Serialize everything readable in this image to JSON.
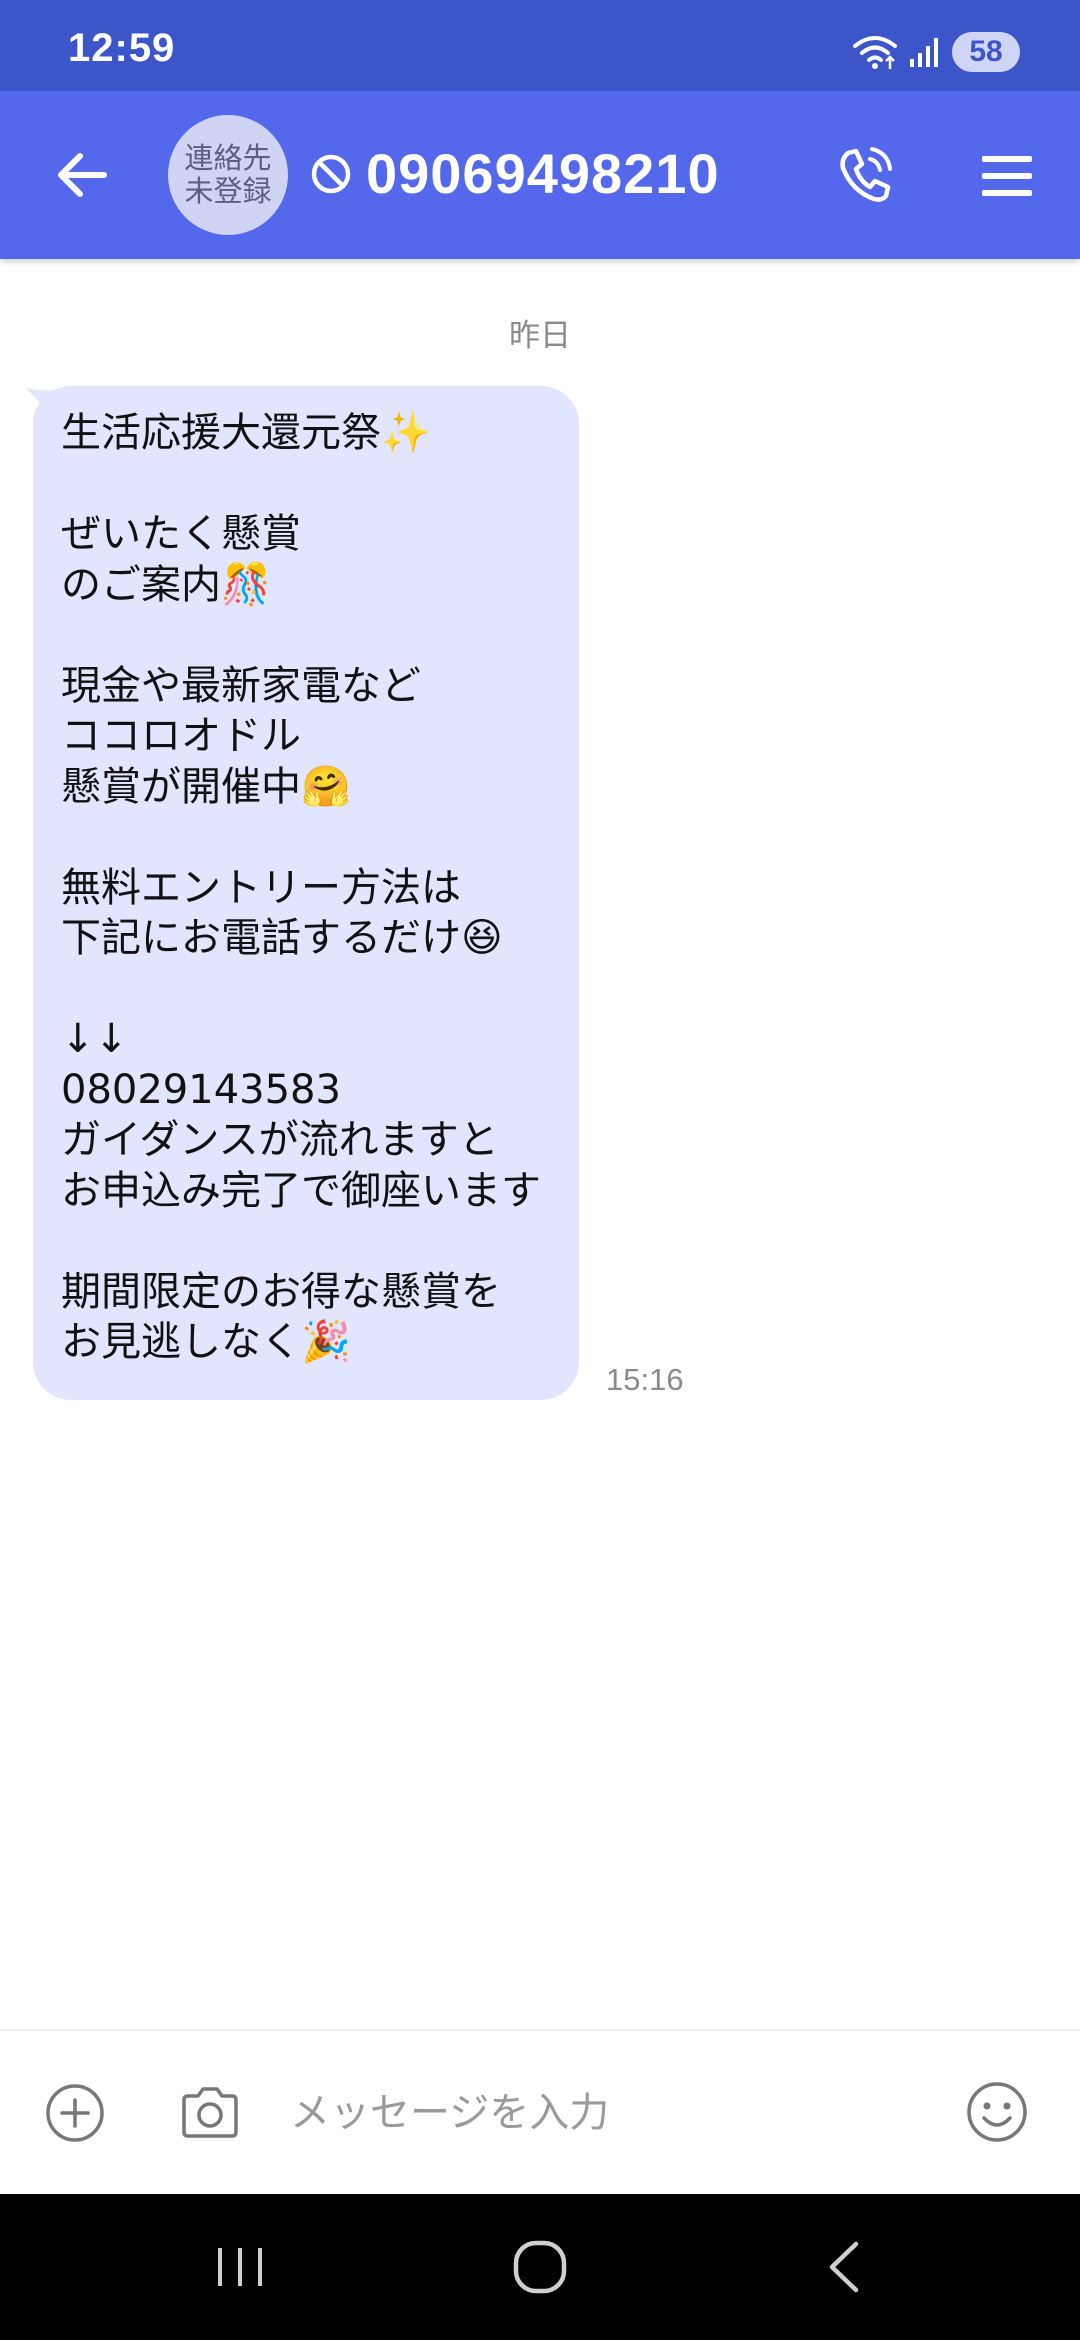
{
  "status_bar": {
    "time": "12:59",
    "battery": "58",
    "icons": [
      "wifi-icon",
      "signal-icon",
      "battery-icon"
    ]
  },
  "header": {
    "avatar_line1": "連絡先",
    "avatar_line2": "未登録",
    "phone_number": "09069498210",
    "icons": [
      "back-arrow-icon",
      "blocked-icon",
      "phone-call-icon",
      "hamburger-menu-icon"
    ],
    "color": "#5468ec"
  },
  "conversation": {
    "date_label": "昨日",
    "messages": [
      {
        "direction": "incoming",
        "time": "15:16",
        "text": "生活応援大還元祭✨\n\nぜいたく懸賞\nのご案内🎊\n\n現金や最新家電など\nココロオドル\n懸賞が開催中🤗\n\n無料エントリー方法は\n下記にお電話するだけ😆\n\n↓↓\n08029143583\nガイダンスが流れますと\nお申込み完了で御座います\n\n期間限定のお得な懸賞を\nお見逃しなく🎉",
        "bubble_color": "#e1e5fd"
      }
    ]
  },
  "input_bar": {
    "placeholder": "メッセージを入力",
    "value": "",
    "icons": [
      "add-circle-icon",
      "camera-icon",
      "emoji-icon"
    ]
  },
  "nav_bar": {
    "icons": [
      "recent-apps-icon",
      "home-icon",
      "back-icon"
    ]
  }
}
